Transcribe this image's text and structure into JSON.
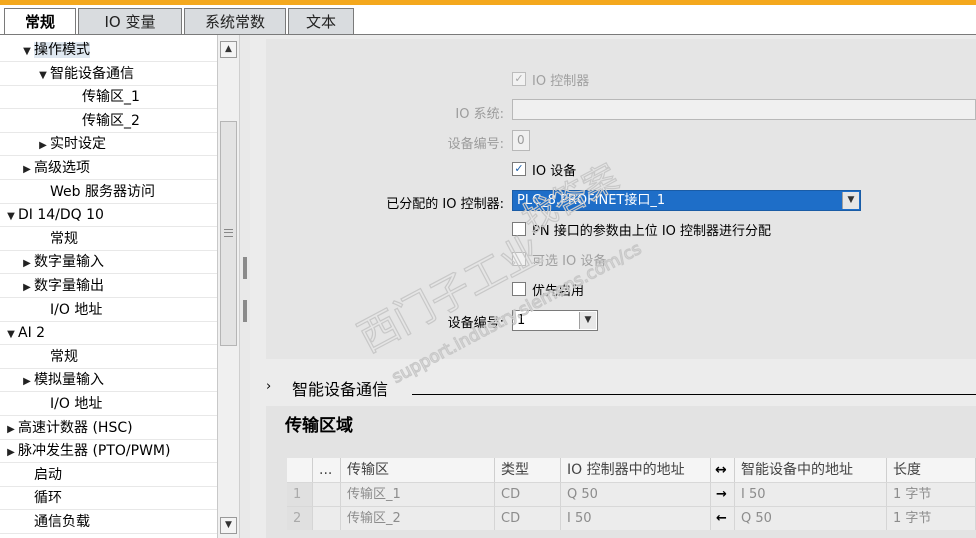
{
  "tabs": [
    "常规",
    "IO 变量",
    "系统常数",
    "文本"
  ],
  "tree": [
    {
      "label": "操作模式",
      "indent": 1,
      "toggle": "▼",
      "selected": true
    },
    {
      "label": "智能设备通信",
      "indent": 2,
      "toggle": "▼"
    },
    {
      "label": "传输区_1",
      "indent": 4,
      "toggle": ""
    },
    {
      "label": "传输区_2",
      "indent": 4,
      "toggle": ""
    },
    {
      "label": "实时设定",
      "indent": 2,
      "toggle": "▶"
    },
    {
      "label": "高级选项",
      "indent": 1,
      "toggle": "▶"
    },
    {
      "label": "Web 服务器访问",
      "indent": 2,
      "toggle": ""
    },
    {
      "label": "DI 14/DQ 10",
      "indent": 0,
      "toggle": "▼"
    },
    {
      "label": "常规",
      "indent": 2,
      "toggle": ""
    },
    {
      "label": "数字量输入",
      "indent": 1,
      "toggle": "▶"
    },
    {
      "label": "数字量输出",
      "indent": 1,
      "toggle": "▶"
    },
    {
      "label": "I/O 地址",
      "indent": 2,
      "toggle": ""
    },
    {
      "label": "AI 2",
      "indent": 0,
      "toggle": "▼"
    },
    {
      "label": "常规",
      "indent": 2,
      "toggle": ""
    },
    {
      "label": "模拟量输入",
      "indent": 1,
      "toggle": "▶"
    },
    {
      "label": "I/O 地址",
      "indent": 2,
      "toggle": ""
    },
    {
      "label": "高速计数器 (HSC)",
      "indent": 0,
      "toggle": "▶"
    },
    {
      "label": "脉冲发生器 (PTO/PWM)",
      "indent": 0,
      "toggle": "▶"
    },
    {
      "label": "启动",
      "indent": 1,
      "toggle": ""
    },
    {
      "label": "循环",
      "indent": 1,
      "toggle": ""
    },
    {
      "label": "通信负载",
      "indent": 1,
      "toggle": ""
    }
  ],
  "form": {
    "io_controller_label": "IO 控制器",
    "io_system_label": "IO 系统:",
    "device_number_label": "设备编号:",
    "device_number_value": "0",
    "io_device_label": "IO 设备",
    "assigned_controller_label": "已分配的 IO 控制器:",
    "assigned_controller_value": "PLC_8.PROFINET接口_1",
    "pn_params_label": "PN 接口的参数由上位 IO 控制器进行分配",
    "optional_device_label": "可选 IO 设备",
    "priority_startup_label": "优先启用",
    "device_number2_label": "设备编号:",
    "device_number2_value": "1"
  },
  "section": {
    "title": "智能设备通信"
  },
  "transfer": {
    "title": "传输区域",
    "headers": [
      "",
      "...",
      "传输区",
      "类型",
      "IO 控制器中的地址",
      "↔",
      "智能设备中的地址",
      "长度"
    ],
    "rows": [
      [
        "1",
        "",
        "传输区_1",
        "CD",
        "Q 50",
        "→",
        "I 50",
        "1 字节"
      ],
      [
        "2",
        "",
        "传输区_2",
        "CD",
        "I 50",
        "←",
        "Q 50",
        "1 字节"
      ]
    ]
  },
  "watermark": {
    "line1": "西门子工业",
    "line2": "找答案",
    "line3": "support.industry.siemens.com/cs"
  },
  "colors": {
    "accent_bar": "#f4a81d",
    "selection_blue": "#1e6ec8"
  }
}
